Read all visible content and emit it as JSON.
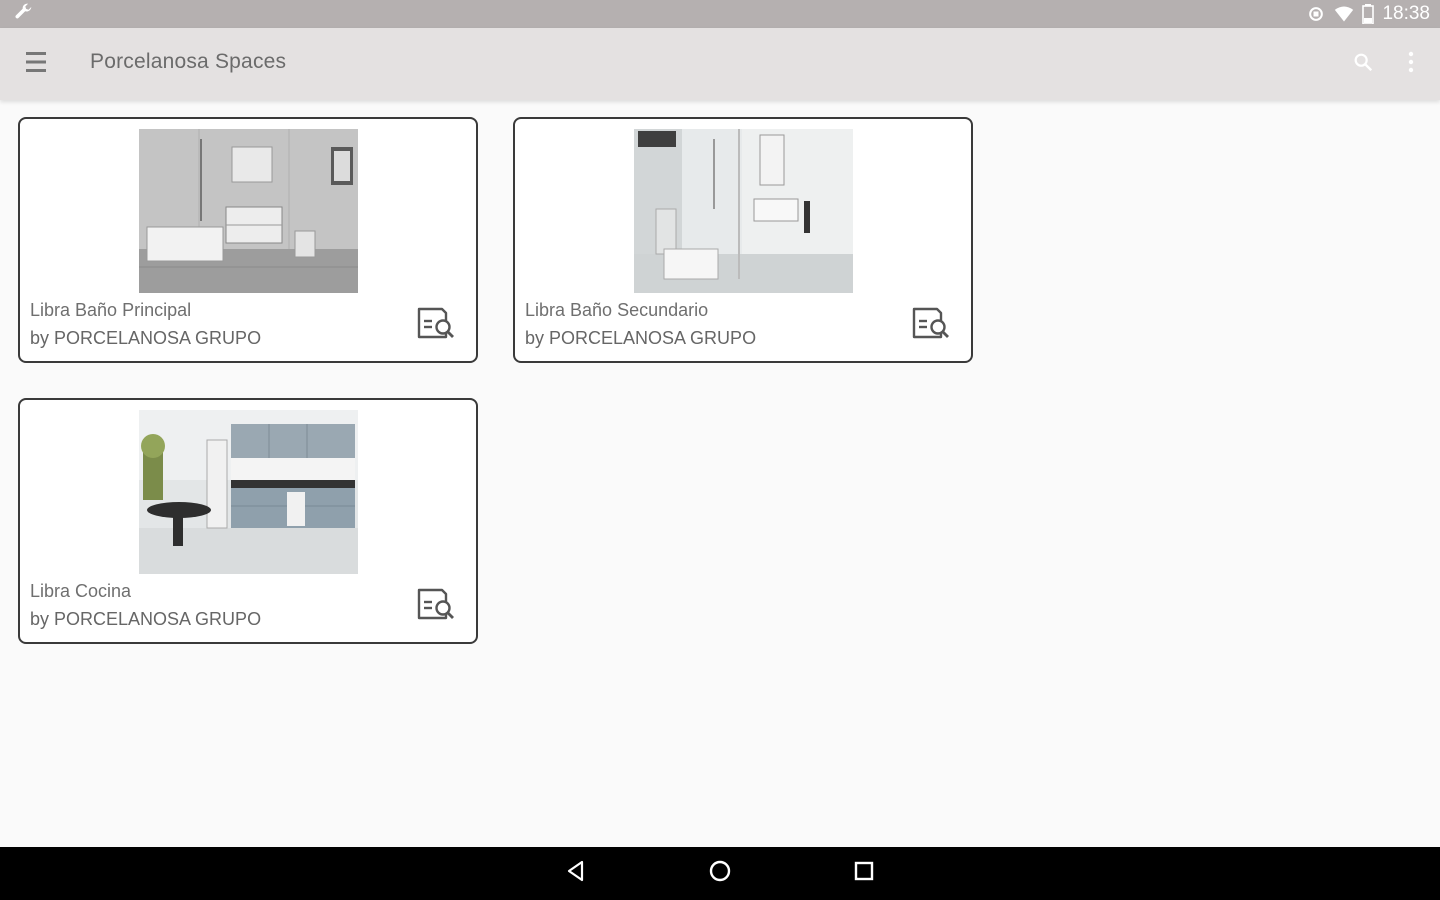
{
  "status_bar": {
    "time": "18:38",
    "icons": [
      "wrench-icon",
      "sync-icon",
      "wifi-icon",
      "battery-icon"
    ]
  },
  "app_bar": {
    "title": "Porcelanosa Spaces",
    "icons": [
      "menu-icon",
      "search-icon",
      "more-vert-icon"
    ]
  },
  "cards": [
    {
      "title": "Libra Baño Principal",
      "subtitle": "by PORCELANOSA GRUPO",
      "icon": "document-search-icon"
    },
    {
      "title": "Libra Baño Secundario",
      "subtitle": "by PORCELANOSA GRUPO",
      "icon": "document-search-icon"
    },
    {
      "title": "Libra Cocina",
      "subtitle": "by PORCELANOSA GRUPO",
      "icon": "document-search-icon"
    }
  ],
  "nav_bar": {
    "icons": [
      "back-icon",
      "home-icon",
      "recents-icon"
    ]
  },
  "colors": {
    "status_bar": "#b5b0b0",
    "app_bar": "#e4e1e1",
    "background": "#fafafa",
    "nav_bar": "#000000",
    "card_border": "#3a3a3a"
  }
}
